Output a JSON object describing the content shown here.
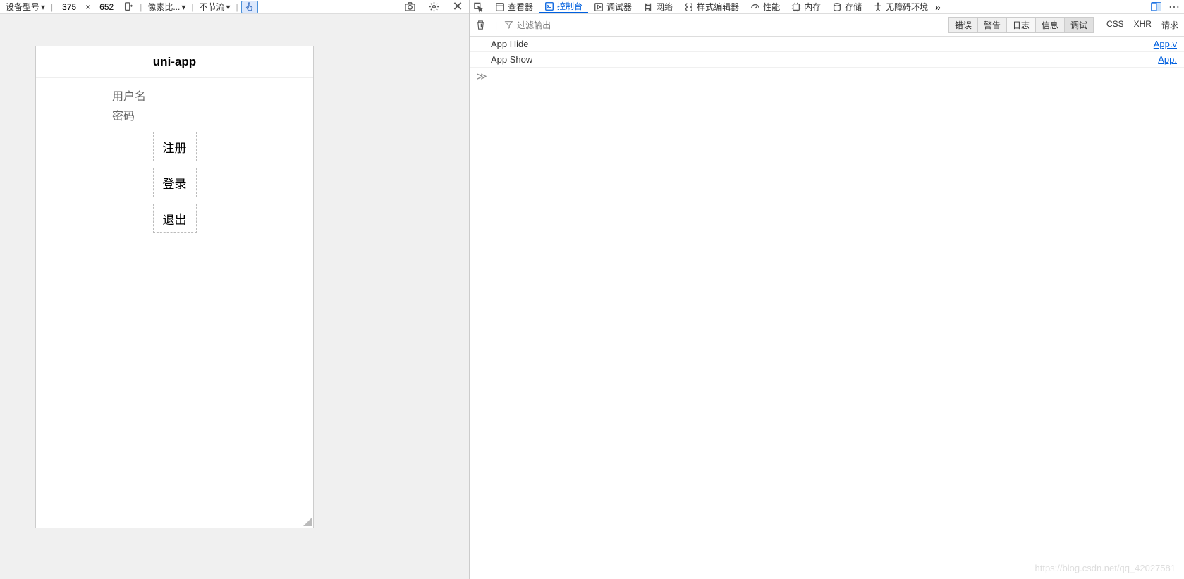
{
  "toolbar": {
    "device_label": "设备型号",
    "width": "375",
    "sep": "×",
    "height": "652",
    "pixel_ratio_label": "像素比...",
    "throttle_label": "不节流"
  },
  "app": {
    "title": "uni-app",
    "labels": {
      "username": "用户名",
      "password": "密码"
    },
    "buttons": {
      "register": "注册",
      "login": "登录",
      "logout": "退出"
    }
  },
  "devtools": {
    "tabs": {
      "inspector": "查看器",
      "console": "控制台",
      "debugger": "调试器",
      "network": "网络",
      "style": "样式编辑器",
      "perf": "性能",
      "memory": "内存",
      "storage": "存储",
      "a11y": "无障碍环境"
    }
  },
  "console": {
    "filter_placeholder": "过滤输出",
    "levels": {
      "error": "错误",
      "warn": "警告",
      "log": "日志",
      "info": "信息",
      "debug": "调试"
    },
    "extra": {
      "css": "CSS",
      "xhr": "XHR",
      "req": "请求"
    },
    "logs": [
      {
        "msg": "App Hide",
        "src": "App.v"
      },
      {
        "msg": "App Show",
        "src": "App."
      }
    ],
    "prompt": "≫"
  },
  "watermark": "https://blog.csdn.net/qq_42027581"
}
